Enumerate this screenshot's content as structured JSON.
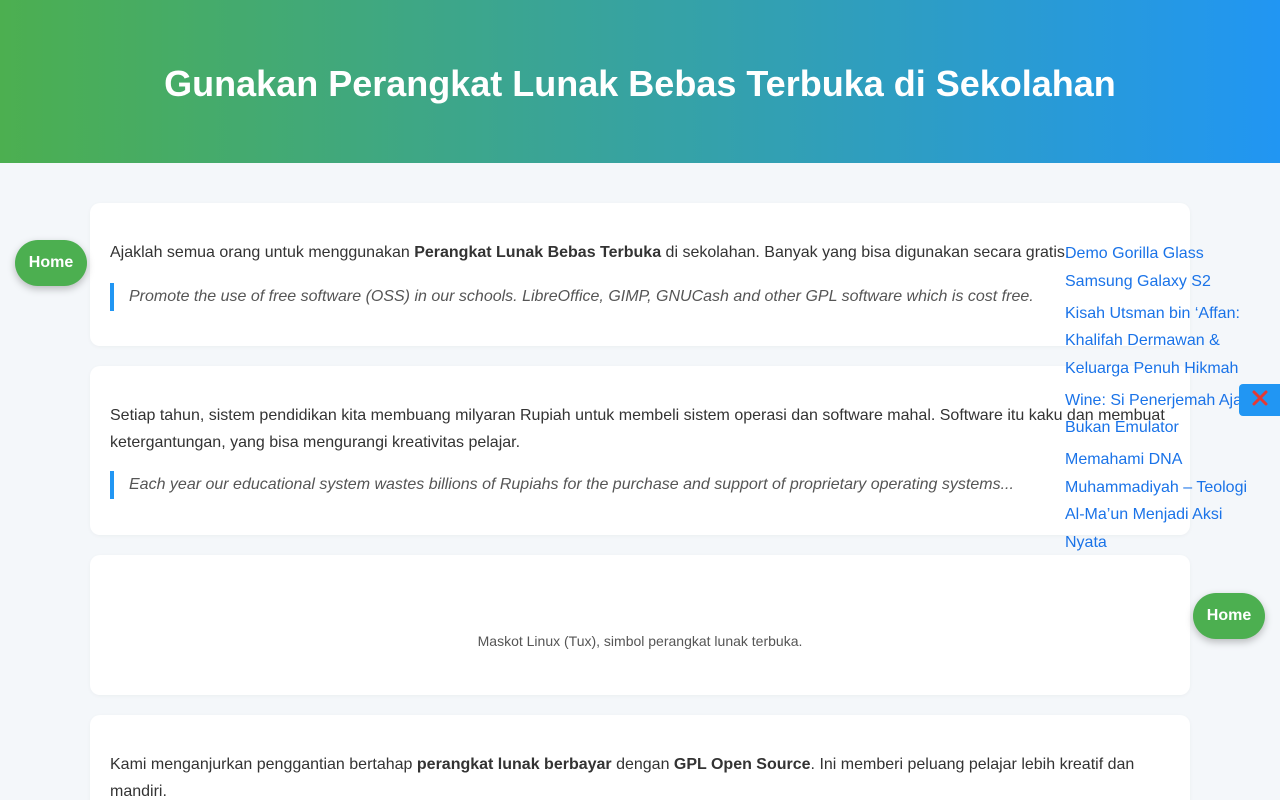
{
  "header": {
    "title": "Gunakan Perangkat Lunak Bebas Terbuka di Sekolahan"
  },
  "cards": [
    {
      "text_before": "Ajaklah semua orang untuk menggunakan ",
      "text_bold": "Perangkat Lunak Bebas Terbuka",
      "text_after": " di sekolahan. Banyak yang bisa digunakan secara gratis.",
      "quote": "Promote the use of free software (OSS) in our schools. LibreOffice, GIMP, GNUCash and other GPL software which is cost free."
    },
    {
      "text": "Setiap tahun, sistem pendidikan kita membuang milyaran Rupiah untuk membeli sistem operasi dan software mahal. Software itu kaku dan membuat ketergantungan, yang bisa mengurangi kreativitas pelajar.",
      "quote": "Each year our educational system wastes billions of Rupiahs for the purchase and support of proprietary operating systems..."
    },
    {
      "caption": "Maskot Linux (Tux), simbol perangkat lunak terbuka."
    },
    {
      "text_1": "Kami menganjurkan penggantian bertahap ",
      "bold_1": "perangkat lunak berbayar",
      "text_2": " dengan ",
      "bold_2": "GPL Open Source",
      "text_3": ". Ini memberi peluang pelajar lebih kreatif dan mandiri."
    }
  ],
  "buttons": {
    "home_left": "Home",
    "home_right": "Home",
    "close_icon": "close-icon"
  },
  "sidebar": {
    "links": [
      "Demo Gorilla Glass Samsung Galaxy S2",
      "Kisah Utsman bin ‘Affan: Khalifah Dermawan & Keluarga Penuh Hikmah",
      "Wine: Si Penerjemah Aja, Bukan Emulator",
      "Memahami DNA Muhammadiyah – Teologi Al-Ma’un Menjadi Aksi Nyata"
    ]
  },
  "colors": {
    "gradient_start": "#4caf50",
    "gradient_end": "#2196f3",
    "link": "#1a73e8",
    "fab": "#4caf50"
  }
}
